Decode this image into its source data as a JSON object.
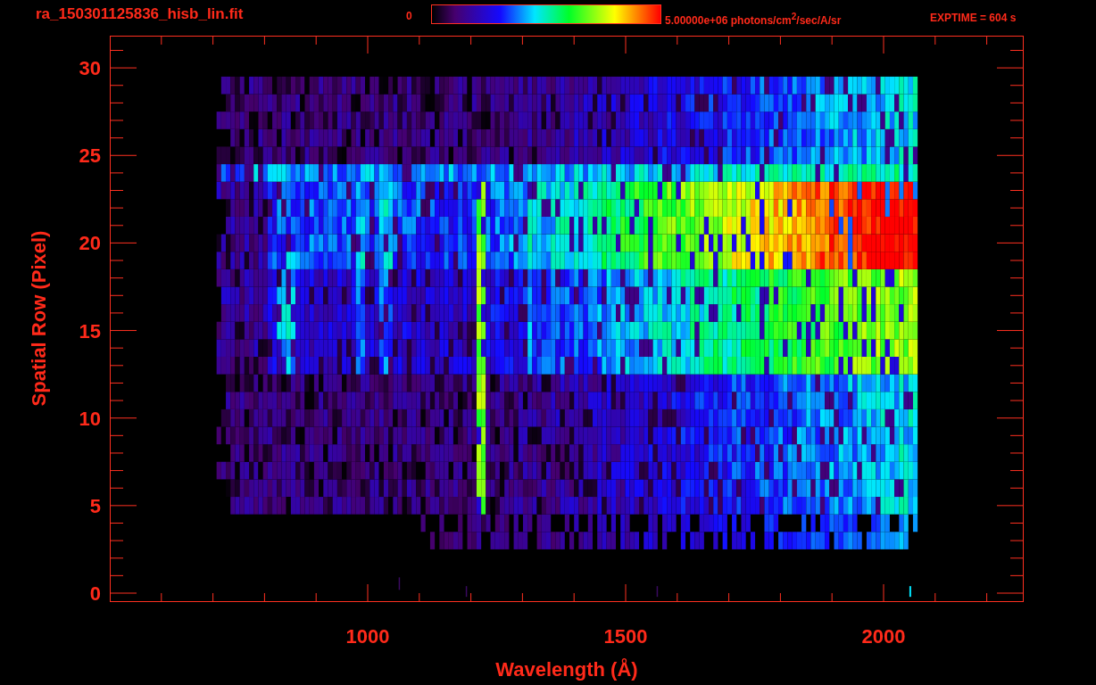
{
  "header": {
    "file_name": "ra_150301125836_hisb_lin.fit",
    "colorbar_min": "0",
    "colorbar_max": "5.00000e+06 photons/cm$^{2}$/sec/A/sr",
    "exposure": "EXPTIME = 604 s"
  },
  "plot": {
    "xlabel": "Wavelength (Å)",
    "ylabel": "Spatial Row (Pixel)",
    "xtick_labels": [
      "1000",
      "1500",
      "2000"
    ],
    "ytick_labels": [
      "30",
      "25",
      "20",
      "15",
      "10",
      "5",
      "0"
    ]
  }
}
